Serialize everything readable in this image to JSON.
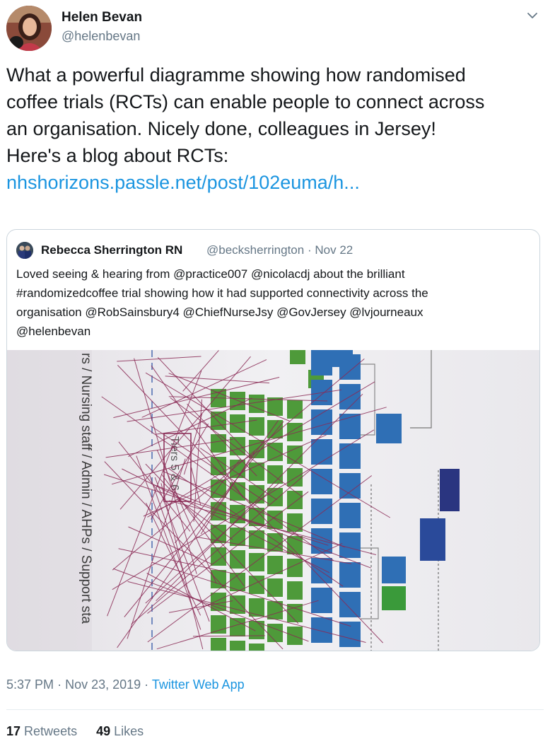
{
  "author": {
    "name": "Helen Bevan",
    "handle": "@helenbevan"
  },
  "tweet": {
    "lines": [
      "What a powerful diagramme showing how randomised",
      "coffee trials (RCTs) can enable people to connect across",
      "an organisation. Nicely done, colleagues in Jersey!",
      "Here's a blog about RCTs:"
    ],
    "link": "nhshorizons.passle.net/post/102euma/h..."
  },
  "quoted_tweet": {
    "name": "Rebecca Sherrington RN",
    "handle": "@becksherrington",
    "separator": "·",
    "date": "Nov 22",
    "lines": [
      "Loved seeing & hearing from @practice007 @nicolacdj about the brilliant",
      "#randomizedcoffee trial showing how it had supported connectivity across the",
      "organisation @RobSainsbury4 @ChiefNurseJsy @GovJersey @lvjourneaux",
      " @helenbevan"
    ],
    "photo": {
      "side_text": "rs / Nursing staff / Admin / AHPs / Support sta",
      "tier_label": "Tiers 5 & 6"
    }
  },
  "meta": {
    "time": "5:37 PM",
    "separator": "·",
    "date": "Nov 23, 2019",
    "source": "Twitter Web App"
  },
  "stats": {
    "retweets_count": "17",
    "retweets_label": "Retweets",
    "likes_count": "49",
    "likes_label": "Likes"
  },
  "colors": {
    "link": "#1b95e0",
    "secondary_text": "#657786",
    "org_box_green": "#4e9a3a",
    "org_box_blue": "#2f6fb5",
    "org_box_navy": "#2a3580",
    "connection_lines": "#8a2a55"
  },
  "icons": {
    "menu": "chevron-down-icon"
  }
}
